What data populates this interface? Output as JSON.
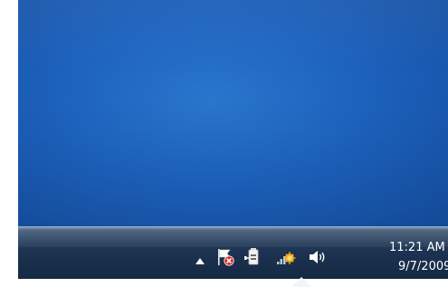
{
  "taskbar": {
    "notification_area": {
      "icons": [
        {
          "name": "show-hidden-icons",
          "icon": "triangle-up-icon"
        },
        {
          "name": "action-center",
          "icon": "flag-with-red-x-icon"
        },
        {
          "name": "power",
          "icon": "battery-plug-icon"
        },
        {
          "name": "network",
          "icon": "network-bars-icon"
        },
        {
          "name": "volume",
          "icon": "speaker-icon"
        }
      ]
    },
    "clock": {
      "time": "11:21 AM",
      "date": "9/7/2009"
    }
  },
  "colors": {
    "desktop": "#1d63bf",
    "taskbar": "#1d3352",
    "clock_text": "#ffffff",
    "action_center_x": "#e03030"
  }
}
